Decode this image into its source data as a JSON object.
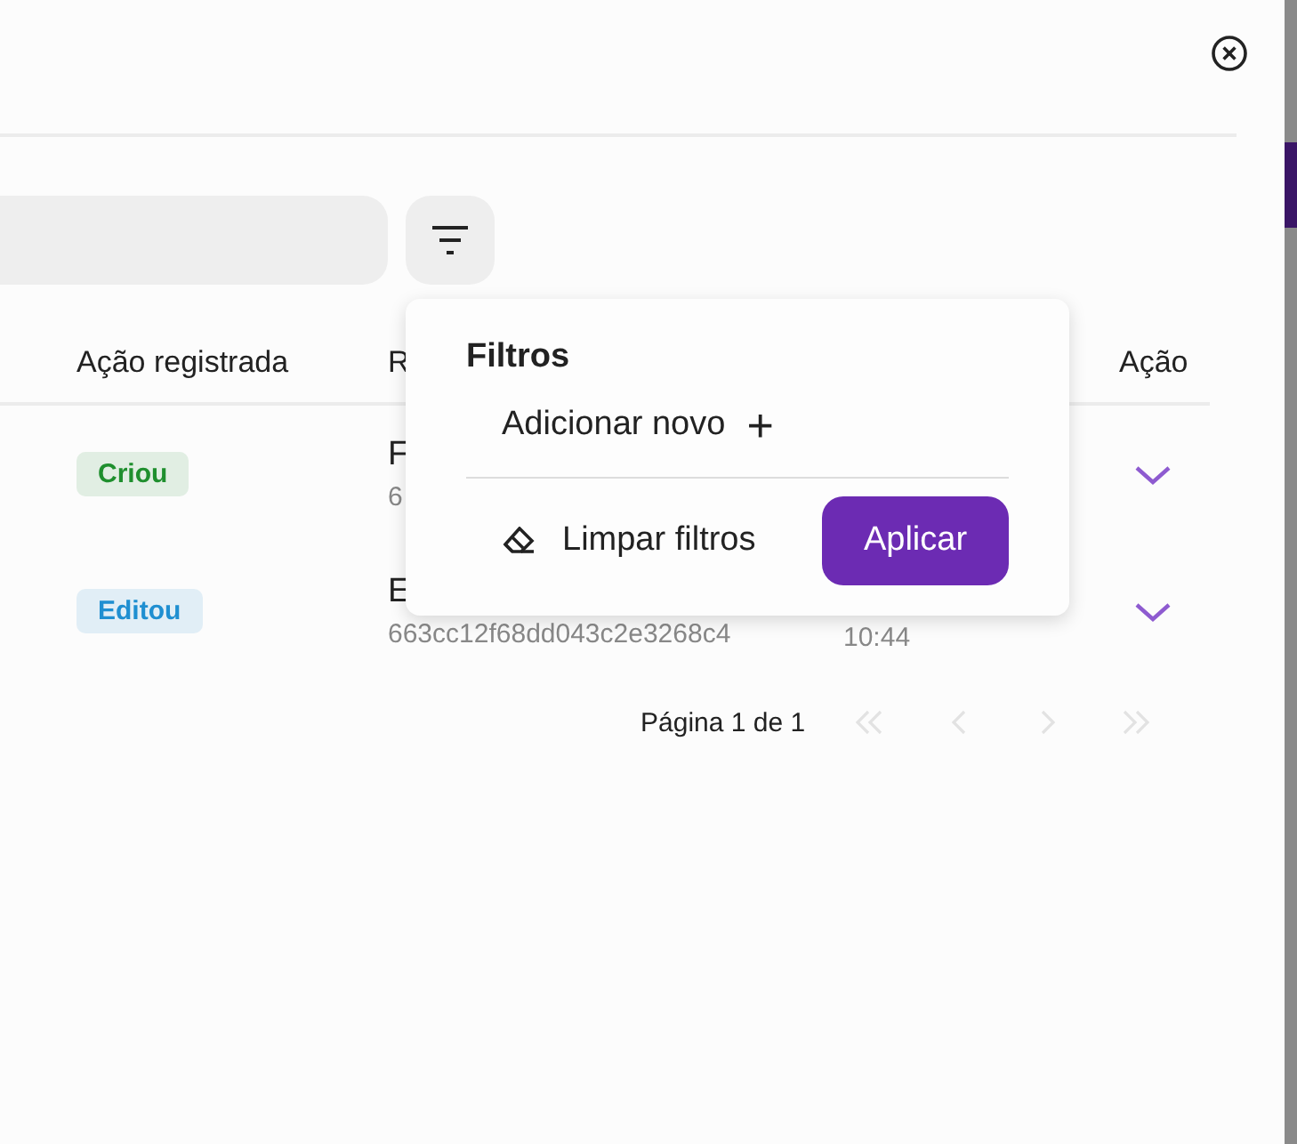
{
  "table": {
    "columns": [
      "Ação registrada",
      "R",
      "",
      "Ação"
    ],
    "rows": [
      {
        "action": {
          "label": "Criou",
          "color": "#1f8f2e"
        },
        "title": "F",
        "id": "6",
        "time": ""
      },
      {
        "action": {
          "label": "Editou",
          "color": "#1f8fd1"
        },
        "title": "E",
        "id": "663cc12f68dd043c2e3268c4",
        "time": "10:44"
      }
    ]
  },
  "pagination": {
    "label": "Página 1 de 1",
    "buttons": [
      {
        "kind": "first",
        "disabled": true
      },
      {
        "kind": "prev",
        "disabled": true
      },
      {
        "kind": "next",
        "disabled": true
      },
      {
        "kind": "last",
        "disabled": true
      }
    ]
  },
  "filter_popup": {
    "title": "Filtros",
    "add_label": "Adicionar novo",
    "add_icon": "+",
    "clear_label": "Limpar filtros",
    "apply_label": "Aplicar"
  }
}
